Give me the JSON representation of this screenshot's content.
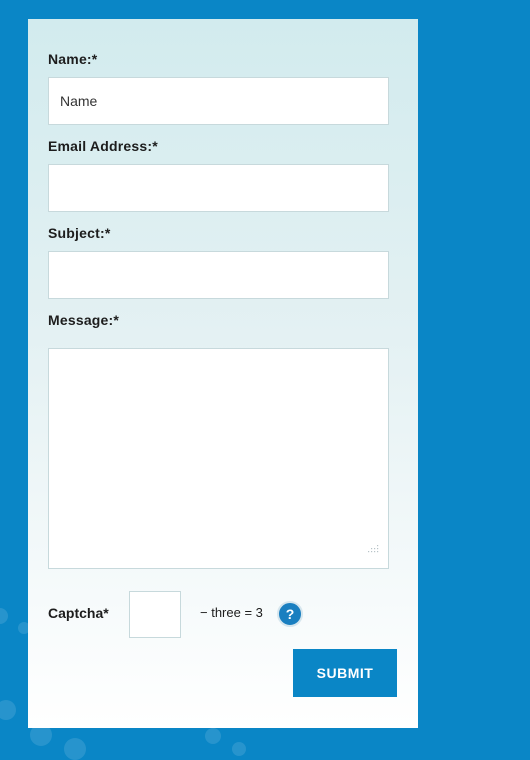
{
  "form": {
    "name_label": "Name:*",
    "name_placeholder": "Name",
    "email_label": "Email Address:*",
    "subject_label": "Subject:*",
    "message_label": "Message:*",
    "captcha_label": "Captcha*",
    "captcha_equation": "− three = 3",
    "help_icon_text": "?",
    "submit_label": "SUBMIT"
  },
  "colors": {
    "page_background": "#0a86c6",
    "button": "#0a86c6",
    "help_icon": "#1a7fc0"
  }
}
